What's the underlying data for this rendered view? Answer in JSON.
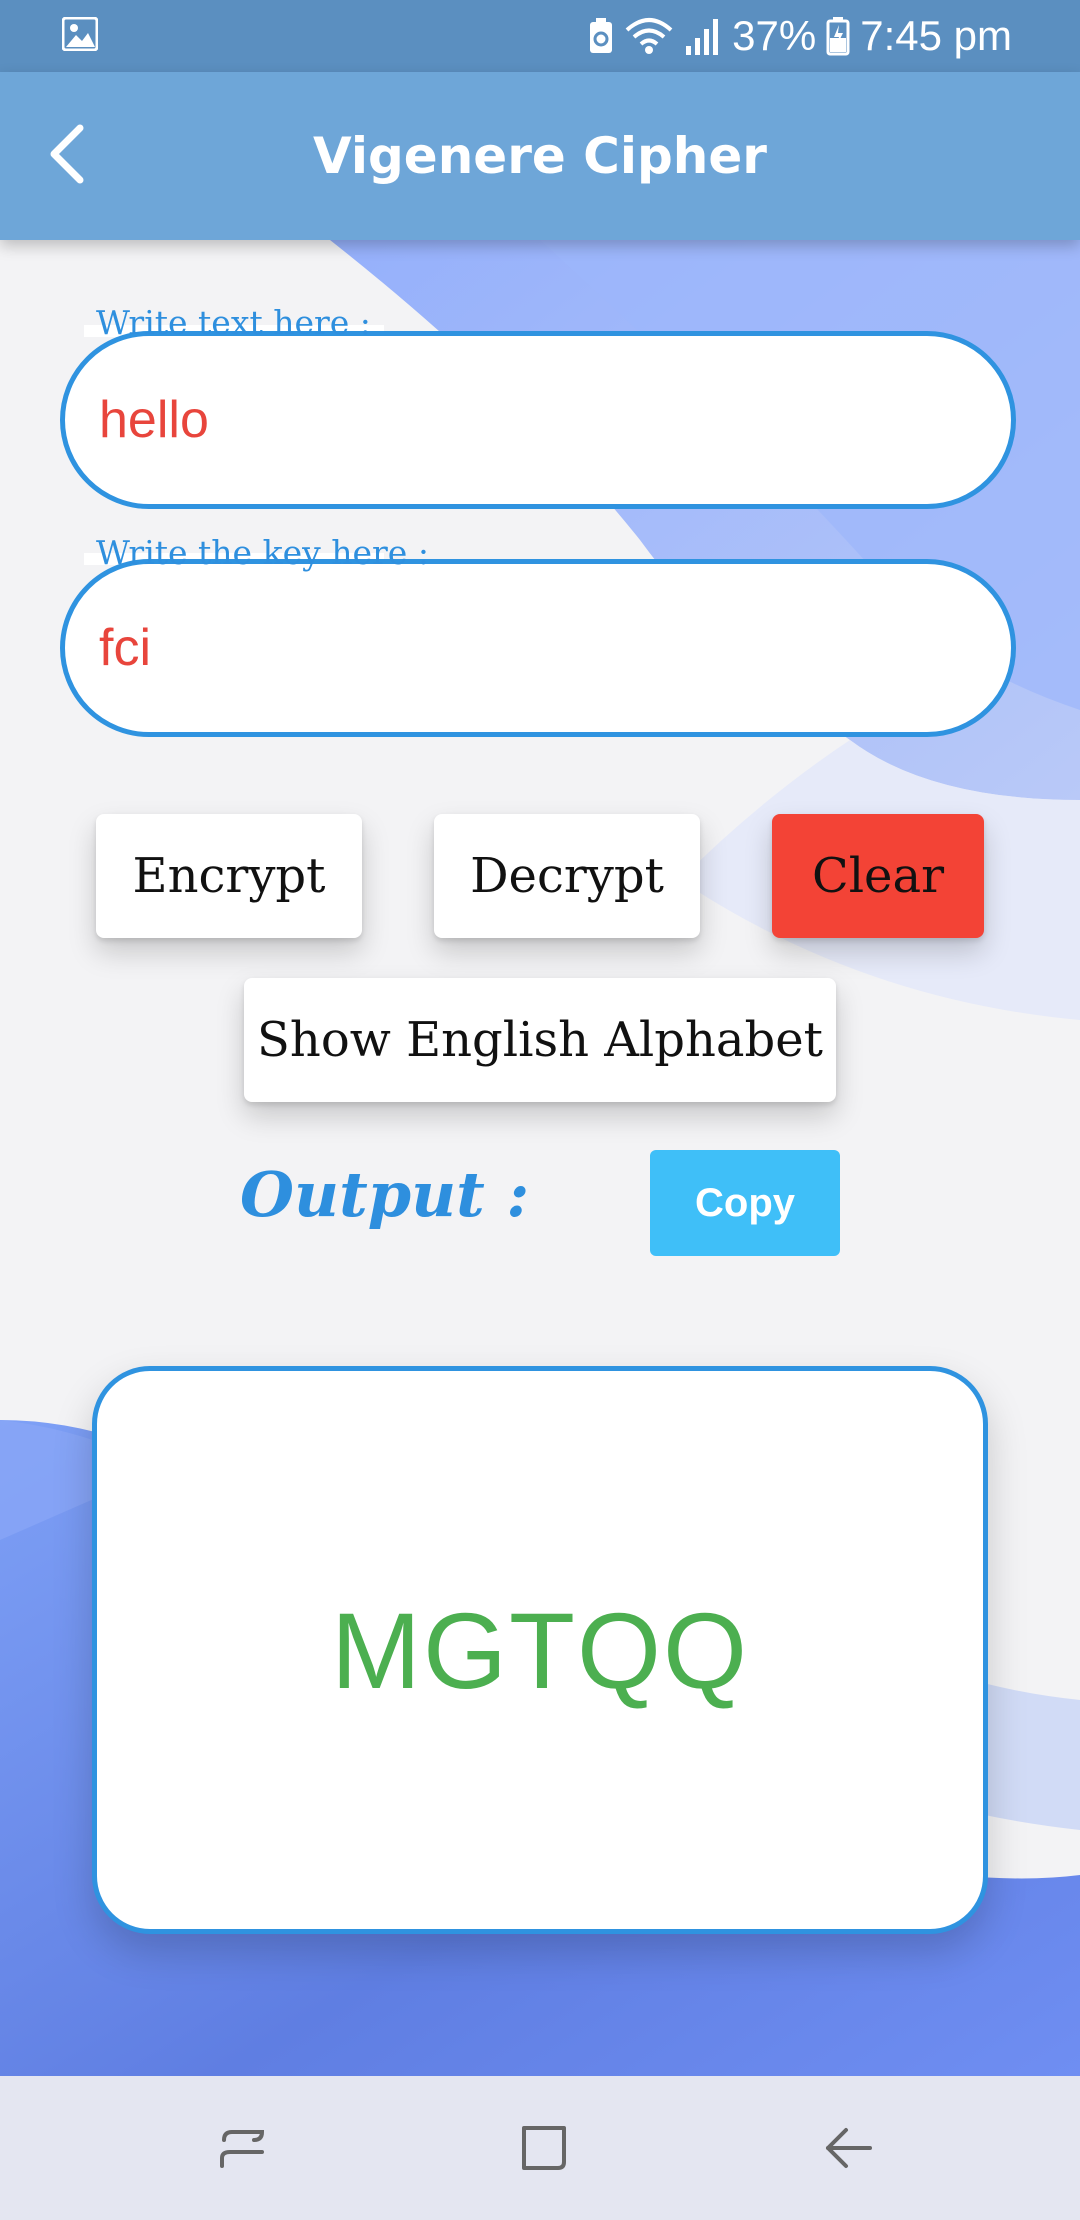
{
  "status_bar": {
    "battery": "37%",
    "time": "7:45 pm",
    "icons": [
      "gallery-icon",
      "battery-saver-icon",
      "wifi-icon",
      "signal-icon",
      "battery-icon"
    ]
  },
  "app_bar": {
    "title": "Vigenere Cipher",
    "back_icon": "back-arrow-icon"
  },
  "form": {
    "text_field": {
      "label": "Write text here :",
      "value": "hello"
    },
    "key_field": {
      "label": "Write the key here :",
      "value": "fci"
    }
  },
  "actions": {
    "encrypt": "Encrypt",
    "decrypt": "Decrypt",
    "clear": "Clear",
    "show_alphabet": "Show English Alphabet"
  },
  "output": {
    "label": "Output :",
    "copy": "Copy",
    "result": "MGTQQ"
  },
  "nav_bar": {
    "icons": [
      "recent-apps-icon",
      "home-icon",
      "back-icon"
    ]
  },
  "colors": {
    "status_bar": "#5b8fc0",
    "app_bar": "#6ea6d8",
    "accent_blue": "#2f93e0",
    "input_text": "#e8453c",
    "clear_button": "#f34336",
    "copy_button": "#3fbff8",
    "result_text": "#4caf50",
    "nav_bar": "#e4e6f1"
  }
}
